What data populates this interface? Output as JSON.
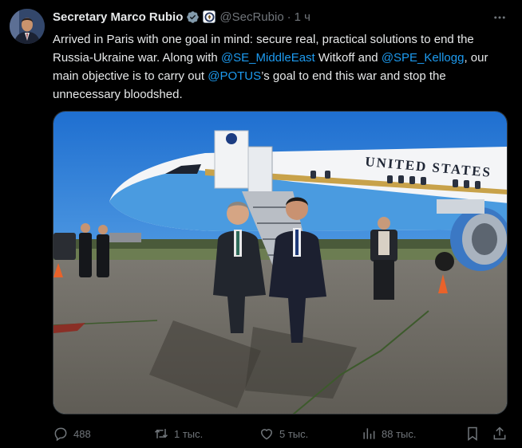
{
  "author": {
    "display_name": "Secretary Marco Rubio",
    "handle": "@SecRubio",
    "separator": "·",
    "time": "1 ч",
    "verified_icon": "verified-badge-icon",
    "affiliation_icon": "state-department-seal-icon"
  },
  "tweet": {
    "text_parts": [
      {
        "text": "Arrived in Paris with one goal in mind: secure real, practical solutions to end the Russia-Ukraine war. Along with "
      },
      {
        "text": "@SE_MiddleEast"
      },
      {
        "text": " Witkoff and "
      },
      {
        "text": "@SPE_Kellogg"
      },
      {
        "text": ", our main objective is to carry out "
      },
      {
        "text": "@POTUS"
      },
      {
        "text": "’s goal to end this war and stop the unnecessary bloodshed."
      }
    ],
    "media_airplane_text": "UNITED STATES"
  },
  "actions": {
    "replies": "488",
    "reposts": "1 тыс.",
    "likes": "5 тыс.",
    "views": "88 тыс."
  },
  "colors": {
    "background": "#000000",
    "text": "#e7e9ea",
    "secondary": "#71767b",
    "link": "#1d9bf0",
    "verified": "#829aab"
  }
}
